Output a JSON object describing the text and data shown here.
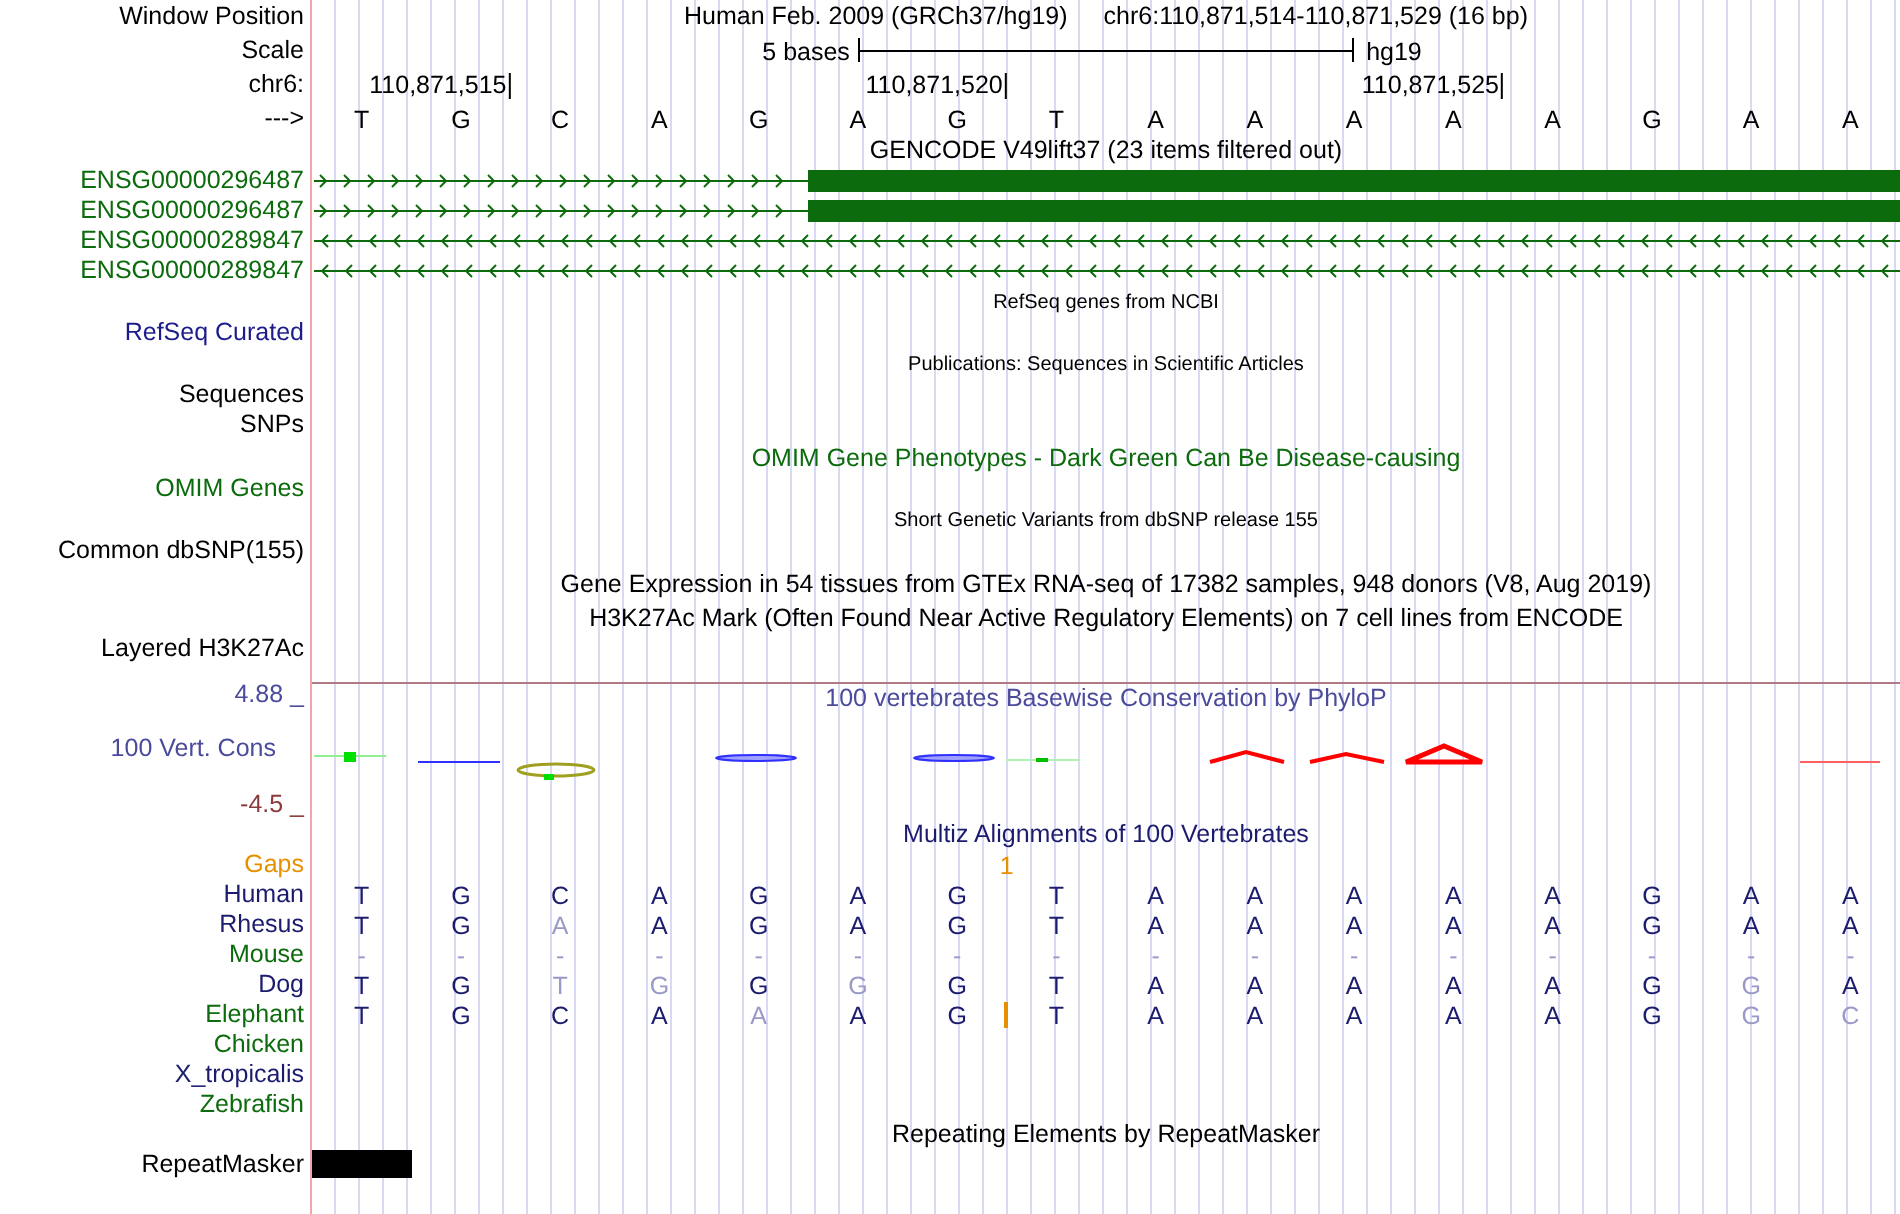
{
  "browser": {
    "title": "Human Feb. 2009 (GRCh37/hg19)",
    "position": "chr6:110,871,514-110,871,529 (16 bp)",
    "labels": [
      "Window Position",
      "Scale",
      "chr6:",
      "--->"
    ],
    "scale": {
      "text": "5 bases",
      "assembly": "hg19"
    },
    "ticks": [
      "110,871,515",
      "110,871,520",
      "110,871,525"
    ],
    "bases": [
      {
        "base": "T"
      },
      {
        "base": "G"
      },
      {
        "base": "C"
      },
      {
        "base": "A"
      },
      {
        "base": "G"
      },
      {
        "base": "A"
      },
      {
        "base": "G",
        "gap": "1"
      },
      {
        "base": "T"
      },
      {
        "base": "A"
      },
      {
        "base": "A"
      },
      {
        "base": "A"
      },
      {
        "base": "A"
      },
      {
        "base": "A"
      },
      {
        "base": "G"
      },
      {
        "base": "A"
      },
      {
        "base": "A"
      }
    ]
  },
  "tracks": [
    {
      "kind": "genes",
      "title": "GENCODE V49lift37 (23 items filtered out)",
      "items": [
        {
          "name": "ENSG00000296487",
          "forward": true,
          "coding": true
        },
        {
          "name": "ENSG00000296487",
          "forward": true,
          "coding": true
        },
        {
          "name": "ENSG00000289847",
          "forward": false,
          "coding": false
        },
        {
          "name": "ENSG00000289847",
          "forward": false,
          "coding": false
        }
      ]
    },
    {
      "kind": "text",
      "title": "RefSeq genes from NCBI",
      "small": true,
      "labels": [
        "RefSeq Curated"
      ],
      "color": "#1c1c8c"
    },
    {
      "kind": "text",
      "title": "Publications: Sequences in Scientific Articles",
      "small": true,
      "labels": [
        "Sequences",
        "SNPs"
      ]
    },
    {
      "kind": "text",
      "title": "OMIM Gene Phenotypes - Dark Green Can Be Disease-causing",
      "small": false,
      "labels": [
        "OMIM Genes"
      ],
      "color": "#0c6b0c"
    },
    {
      "kind": "text",
      "title": "Short Genetic Variants from dbSNP release 155",
      "small": true,
      "labels": [
        "Common dbSNP(155)"
      ]
    },
    {
      "kind": "text",
      "title": "Gene Expression in 54 tissues from GTEx RNA-seq of 17382 samples, 948 donors (V8, Aug 2019)",
      "small": false
    },
    {
      "kind": "text",
      "title": "H3K27Ac Mark (Often Found Near Active Regulatory Elements) on 7 cell lines from ENCODE",
      "small": false,
      "labels": [
        "Layered H3K27Ac"
      ]
    },
    {
      "kind": "conservation",
      "title": "100 vertebrates Basewise Conservation by PhyloP",
      "upper": "4.88 _",
      "label": "100 Vert. Cons",
      "lower": "-4.5 _"
    },
    {
      "kind": "alignment",
      "title": "Multiz Alignments of 100 Vertebrates",
      "gaps_label": "Gaps",
      "species": [
        {
          "name": "Human",
          "color": "#1c1c6e",
          "bases": [
            {
              "b": "T",
              "faded": false
            },
            {
              "b": "G",
              "faded": false
            },
            {
              "b": "C",
              "faded": false
            },
            {
              "b": "A",
              "faded": false
            },
            {
              "b": "G",
              "faded": false
            },
            {
              "b": "A",
              "faded": false
            },
            {
              "b": "G",
              "faded": false
            },
            {
              "b": "T",
              "faded": false
            },
            {
              "b": "A",
              "faded": false
            },
            {
              "b": "A",
              "faded": false
            },
            {
              "b": "A",
              "faded": false
            },
            {
              "b": "A",
              "faded": false
            },
            {
              "b": "A",
              "faded": false
            },
            {
              "b": "G",
              "faded": false
            },
            {
              "b": "A",
              "faded": false
            },
            {
              "b": "A",
              "faded": false
            }
          ]
        },
        {
          "name": "Rhesus",
          "color": "#1c1c6e",
          "bases": [
            {
              "b": "T",
              "faded": false
            },
            {
              "b": "G",
              "faded": false
            },
            {
              "b": "A",
              "faded": true
            },
            {
              "b": "A",
              "faded": false
            },
            {
              "b": "G",
              "faded": false
            },
            {
              "b": "A",
              "faded": false
            },
            {
              "b": "G",
              "faded": false
            },
            {
              "b": "T",
              "faded": false
            },
            {
              "b": "A",
              "faded": false
            },
            {
              "b": "A",
              "faded": false
            },
            {
              "b": "A",
              "faded": false
            },
            {
              "b": "A",
              "faded": false
            },
            {
              "b": "A",
              "faded": false
            },
            {
              "b": "G",
              "faded": false
            },
            {
              "b": "A",
              "faded": false
            },
            {
              "b": "A",
              "faded": false
            }
          ]
        },
        {
          "name": "Mouse",
          "color": "#0c6b0c",
          "bases": [
            {
              "b": "-",
              "faded": true
            },
            {
              "b": "-",
              "faded": true
            },
            {
              "b": "-",
              "faded": true
            },
            {
              "b": "-",
              "faded": true
            },
            {
              "b": "-",
              "faded": true
            },
            {
              "b": "-",
              "faded": true
            },
            {
              "b": "-",
              "faded": true
            },
            {
              "b": "-",
              "faded": true
            },
            {
              "b": "-",
              "faded": true
            },
            {
              "b": "-",
              "faded": true
            },
            {
              "b": "-",
              "faded": true
            },
            {
              "b": "-",
              "faded": true
            },
            {
              "b": "-",
              "faded": true
            },
            {
              "b": "-",
              "faded": true
            },
            {
              "b": "-",
              "faded": true
            },
            {
              "b": "-",
              "faded": true
            }
          ]
        },
        {
          "name": "Dog",
          "color": "#1c1c6e",
          "bases": [
            {
              "b": "T",
              "faded": false
            },
            {
              "b": "G",
              "faded": false
            },
            {
              "b": "T",
              "faded": true
            },
            {
              "b": "G",
              "faded": true
            },
            {
              "b": "G",
              "faded": false
            },
            {
              "b": "G",
              "faded": true
            },
            {
              "b": "G",
              "faded": false
            },
            {
              "b": "T",
              "faded": false
            },
            {
              "b": "A",
              "faded": false
            },
            {
              "b": "A",
              "faded": false
            },
            {
              "b": "A",
              "faded": false
            },
            {
              "b": "A",
              "faded": false
            },
            {
              "b": "A",
              "faded": false
            },
            {
              "b": "G",
              "faded": false
            },
            {
              "b": "G",
              "faded": true
            },
            {
              "b": "A",
              "faded": false
            }
          ]
        },
        {
          "name": "Elephant",
          "color": "#0c6b0c",
          "bases": [
            {
              "b": "T",
              "faded": false
            },
            {
              "b": "G",
              "faded": false
            },
            {
              "b": "C",
              "faded": false
            },
            {
              "b": "A",
              "faded": false
            },
            {
              "b": "A",
              "faded": true
            },
            {
              "b": "A",
              "faded": false
            },
            {
              "b": "G",
              "faded": false,
              "insertion": true
            },
            {
              "b": "T",
              "faded": false
            },
            {
              "b": "A",
              "faded": false
            },
            {
              "b": "A",
              "faded": false
            },
            {
              "b": "A",
              "faded": false
            },
            {
              "b": "A",
              "faded": false
            },
            {
              "b": "A",
              "faded": false
            },
            {
              "b": "G",
              "faded": false
            },
            {
              "b": "G",
              "faded": true
            },
            {
              "b": "C",
              "faded": true
            }
          ]
        },
        {
          "name": "Chicken",
          "color": "#0c6b0c"
        },
        {
          "name": "X_tropicalis",
          "color": "#1c1c6e"
        },
        {
          "name": "Zebrafish",
          "color": "#0c6b0c"
        }
      ]
    },
    {
      "kind": "repeats",
      "title": "Repeating Elements by RepeatMasker",
      "label": "RepeatMasker"
    }
  ]
}
